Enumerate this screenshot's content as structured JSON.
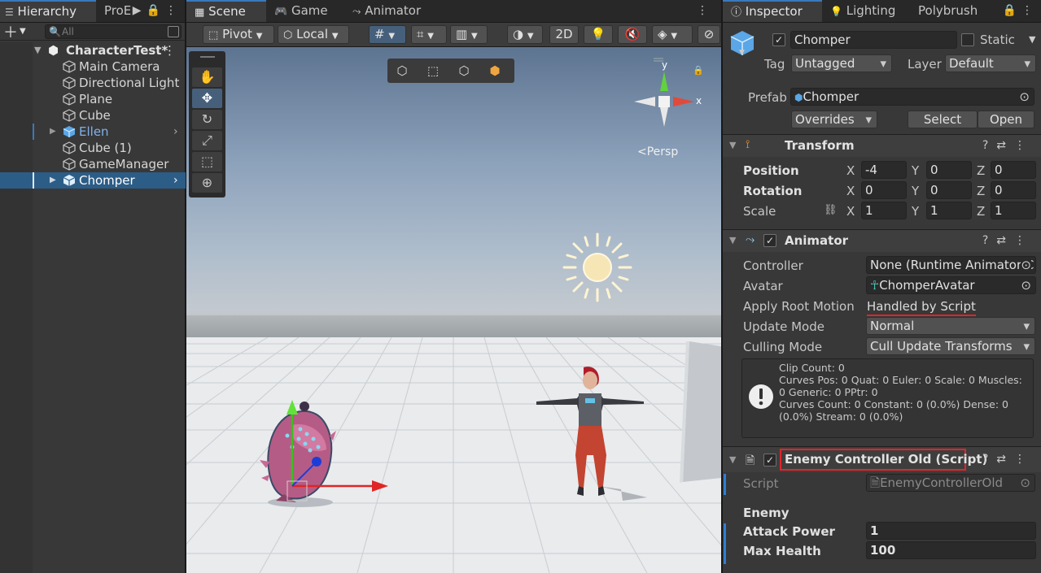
{
  "hierarchy": {
    "tab_label": "Hierarchy",
    "tab2_label": "ProE",
    "search_placeholder": "All",
    "scene_name": "CharacterTest*",
    "items": [
      {
        "label": "Main Camera"
      },
      {
        "label": "Directional Light"
      },
      {
        "label": "Plane"
      },
      {
        "label": "Cube"
      },
      {
        "label": "Ellen"
      },
      {
        "label": "Cube (1)"
      },
      {
        "label": "GameManager"
      },
      {
        "label": "Chomper"
      }
    ]
  },
  "scene_panel": {
    "tabs": [
      "Scene",
      "Game",
      "Animator"
    ],
    "pivot_label": "Pivot",
    "local_label": "Local",
    "mode_2d": "2D",
    "persp_label": "<Persp",
    "axis_y": "y",
    "axis_x": "x"
  },
  "inspector": {
    "tabs": [
      "Inspector",
      "Lighting",
      "Polybrush"
    ],
    "object_name": "Chomper",
    "static_label": "Static",
    "tag_label": "Tag",
    "tag_value": "Untagged",
    "layer_label": "Layer",
    "layer_value": "Default",
    "prefab_label": "Prefab",
    "prefab_value": "Chomper",
    "overrides_label": "Overrides",
    "select_label": "Select",
    "open_label": "Open",
    "transform": {
      "title": "Transform",
      "position_label": "Position",
      "rotation_label": "Rotation",
      "scale_label": "Scale",
      "position": {
        "x": "-4",
        "y": "0",
        "z": "0"
      },
      "rotation": {
        "x": "0",
        "y": "0",
        "z": "0"
      },
      "scale": {
        "x": "1",
        "y": "1",
        "z": "1"
      },
      "axis_x": "X",
      "axis_y": "Y",
      "axis_z": "Z"
    },
    "animator": {
      "title": "Animator",
      "controller_label": "Controller",
      "controller_value": "None (Runtime Animator C",
      "avatar_label": "Avatar",
      "avatar_value": "ChomperAvatar",
      "root_motion_label": "Apply Root Motion",
      "root_motion_value": "Handled by Script",
      "update_mode_label": "Update Mode",
      "update_mode_value": "Normal",
      "culling_mode_label": "Culling Mode",
      "culling_mode_value": "Cull Update Transforms",
      "info_text": "Clip Count: 0\nCurves Pos: 0 Quat: 0 Euler: 0 Scale: 0 Muscles: 0 Generic: 0 PPtr: 0\nCurves Count: 0 Constant: 0 (0.0%) Dense: 0 (0.0%) Stream: 0 (0.0%)"
    },
    "enemy_controller": {
      "title": "Enemy Controller Old (Script)",
      "script_label": "Script",
      "script_value": "EnemyControllerOld",
      "section_label": "Enemy",
      "attack_power_label": "Attack Power",
      "attack_power_value": "1",
      "max_health_label": "Max Health",
      "max_health_value": "100"
    }
  },
  "colors": {
    "selection": "#2c5d87",
    "accent_blue": "#3a79bb",
    "highlight_red": "#e0262b",
    "ellen_blue": "#7fb2ea"
  }
}
